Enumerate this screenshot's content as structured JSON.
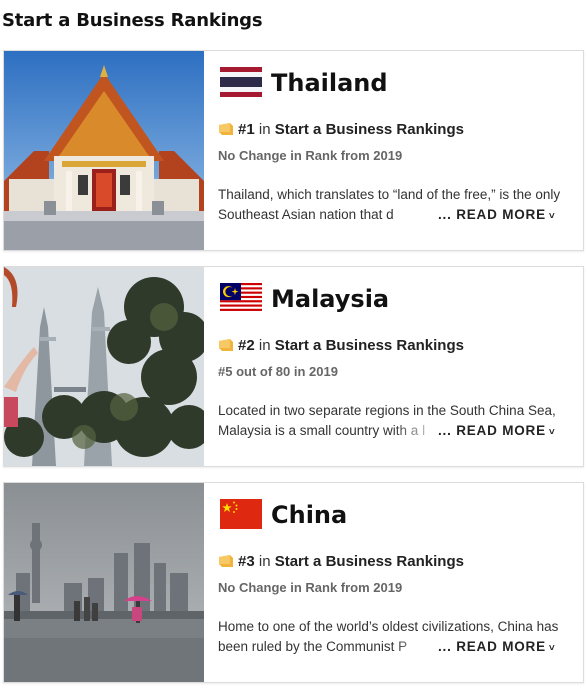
{
  "page": {
    "title": "Start a Business Rankings"
  },
  "items": [
    {
      "country": "Thailand",
      "rank_prefix": "#1",
      "rank_in": "in",
      "ranking_name": "Start a Business Rankings",
      "change": "No Change in Rank from 2019",
      "description": "Thailand, which translates to “land of the free,” is the only Southeast Asian nation that d",
      "read_more": "... READ MORE",
      "chevron": "˅"
    },
    {
      "country": "Malaysia",
      "rank_prefix": "#2",
      "rank_in": "in",
      "ranking_name": "Start a Business Rankings",
      "change": "#5 out of 80 in 2019",
      "description": "Located in two separate regions in the South China Sea, Malaysia is a small country with a l",
      "read_more": "... READ MORE",
      "chevron": "˅"
    },
    {
      "country": "China",
      "rank_prefix": "#3",
      "rank_in": "in",
      "ranking_name": "Start a Business Rankings",
      "change": "No Change in Rank from 2019",
      "description": "Home to one of the world’s oldest civilizations, China has been ruled by the Communist P",
      "read_more": "... READ MORE",
      "chevron": "˅"
    }
  ],
  "colors": {
    "ribbon_icon": "#f2b33d",
    "text": "#222222",
    "muted": "#666666"
  }
}
